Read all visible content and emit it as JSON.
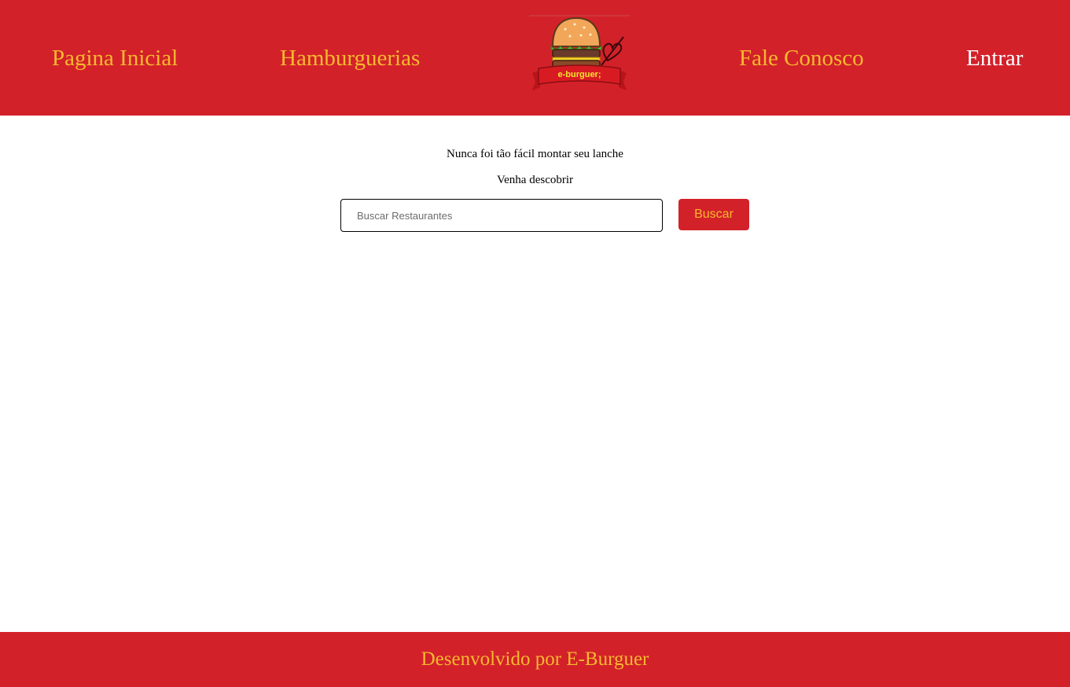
{
  "header": {
    "nav": {
      "home": "Pagina Inicial",
      "burger_shops": "Hamburguerias",
      "contact": "Fale Conosco",
      "login": "Entrar"
    },
    "logo": {
      "alt": "e-burguer logo",
      "banner_text": "e-burguer;"
    }
  },
  "main": {
    "tagline_primary": "Nunca foi tão fácil montar seu lanche",
    "tagline_secondary": "Venha descobrir",
    "search": {
      "placeholder": "Buscar Restaurantes",
      "value": "",
      "button_label": "Buscar"
    }
  },
  "footer": {
    "text": "Desenvolvido por E-Burguer"
  },
  "colors": {
    "brand_red": "#d3212a",
    "accent_yellow": "#f6b92d",
    "white": "#ffffff"
  }
}
